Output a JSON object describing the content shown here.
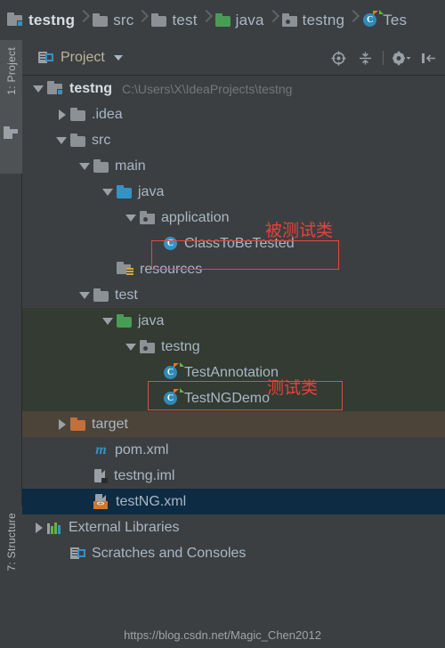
{
  "breadcrumb": {
    "items": [
      {
        "label": "testng",
        "icon": "module-folder-icon",
        "bold": true
      },
      {
        "label": "src",
        "icon": "folder-icon",
        "bold": false
      },
      {
        "label": "test",
        "icon": "folder-icon",
        "bold": false
      },
      {
        "label": "java",
        "icon": "folder-green-icon",
        "bold": false
      },
      {
        "label": "testng",
        "icon": "package-icon",
        "bold": false
      },
      {
        "label": "Tes",
        "icon": "testng-class-icon",
        "bold": false
      }
    ]
  },
  "sidebar": {
    "top_tool": {
      "label": "1: Project",
      "icon": "project-icon"
    },
    "bottom_tool": {
      "label": "7: Structure",
      "icon": "structure-icon"
    }
  },
  "panel": {
    "title": "Project",
    "tools": [
      {
        "name": "locate-icon",
        "title": "Select Opened File"
      },
      {
        "name": "collapse-all-icon",
        "title": "Collapse All"
      },
      {
        "name": "settings-gear-icon",
        "title": "Settings"
      },
      {
        "name": "hide-panel-icon",
        "title": "Hide"
      }
    ]
  },
  "tree": {
    "rows": [
      {
        "label": "testng",
        "sub": "C:\\Users\\X\\IdeaProjects\\testng",
        "icon": "module-folder-icon",
        "arrow": "expanded",
        "indent": 0,
        "bold": true,
        "style": "normal"
      },
      {
        "label": ".idea",
        "sub": "",
        "icon": "folder-icon",
        "arrow": "collapsed",
        "indent": 1,
        "bold": false,
        "style": "normal"
      },
      {
        "label": "src",
        "sub": "",
        "icon": "folder-icon",
        "arrow": "expanded",
        "indent": 1,
        "bold": false,
        "style": "normal"
      },
      {
        "label": "main",
        "sub": "",
        "icon": "folder-icon",
        "arrow": "expanded",
        "indent": 2,
        "bold": false,
        "style": "normal"
      },
      {
        "label": "java",
        "sub": "",
        "icon": "folder-teal-icon",
        "arrow": "expanded",
        "indent": 3,
        "bold": false,
        "style": "normal"
      },
      {
        "label": "application",
        "sub": "",
        "icon": "package-icon",
        "arrow": "expanded",
        "indent": 4,
        "bold": false,
        "style": "normal"
      },
      {
        "label": "ClassToBeTested",
        "sub": "",
        "icon": "java-class-icon",
        "arrow": "none",
        "indent": 5,
        "bold": false,
        "style": "normal"
      },
      {
        "label": "resources",
        "sub": "",
        "icon": "resources-folder-icon",
        "arrow": "none",
        "indent": 3,
        "bold": false,
        "style": "normal"
      },
      {
        "label": "test",
        "sub": "",
        "icon": "folder-icon",
        "arrow": "expanded",
        "indent": 2,
        "bold": false,
        "style": "normal"
      },
      {
        "label": "java",
        "sub": "",
        "icon": "folder-green-icon",
        "arrow": "expanded",
        "indent": 3,
        "bold": false,
        "style": "src-test"
      },
      {
        "label": "testng",
        "sub": "",
        "icon": "package-icon",
        "arrow": "expanded",
        "indent": 4,
        "bold": false,
        "style": "src-test"
      },
      {
        "label": "TestAnnotation",
        "sub": "",
        "icon": "testng-class-icon",
        "arrow": "none",
        "indent": 5,
        "bold": false,
        "style": "src-test"
      },
      {
        "label": "TestNGDemo",
        "sub": "",
        "icon": "testng-class-icon",
        "arrow": "none",
        "indent": 5,
        "bold": false,
        "style": "src-test"
      },
      {
        "label": "target",
        "sub": "",
        "icon": "folder-orange-icon",
        "arrow": "collapsed",
        "indent": 1,
        "bold": false,
        "style": "excluded"
      },
      {
        "label": "pom.xml",
        "sub": "",
        "icon": "maven-icon",
        "arrow": "none",
        "indent": 2,
        "bold": false,
        "style": "normal"
      },
      {
        "label": "testng.iml",
        "sub": "",
        "icon": "iml-module-icon",
        "arrow": "none",
        "indent": 2,
        "bold": false,
        "style": "normal"
      },
      {
        "label": "testNG.xml",
        "sub": "",
        "icon": "xml-file-icon",
        "arrow": "none",
        "indent": 2,
        "bold": false,
        "style": "selected"
      },
      {
        "label": "External Libraries",
        "sub": "",
        "icon": "external-libraries-icon",
        "arrow": "collapsed",
        "indent": 0,
        "bold": false,
        "style": "normal"
      },
      {
        "label": "Scratches and Consoles",
        "sub": "",
        "icon": "scratches-icon",
        "arrow": "none",
        "indent": 1,
        "bold": false,
        "style": "normal"
      }
    ]
  },
  "annotations": {
    "color": "#E8413A",
    "items": [
      {
        "text": "被测试类",
        "type": "label"
      },
      {
        "text": "测试类",
        "type": "label"
      }
    ],
    "label_tested_class": "被测试类",
    "label_test_class": "测试类"
  },
  "watermark": {
    "text": "https://blog.csdn.net/Magic_Chen2012"
  }
}
